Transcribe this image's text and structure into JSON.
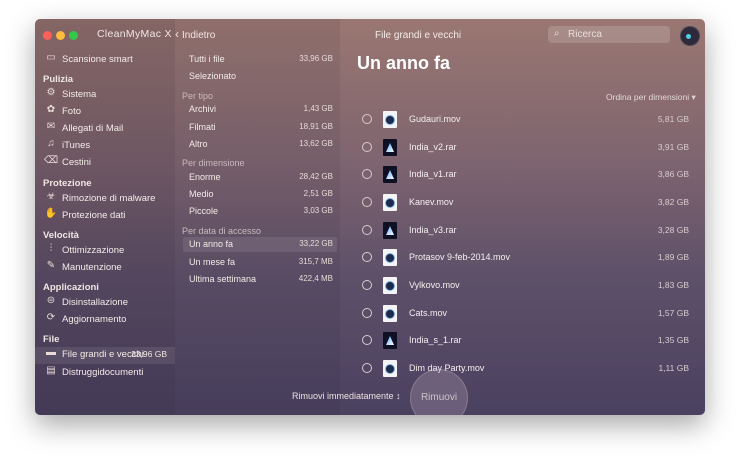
{
  "app": {
    "title": "CleanMyMac X",
    "window_title": "File grandi e vecchi"
  },
  "toolbar": {
    "back_label": "Indietro"
  },
  "search": {
    "placeholder": "Ricerca"
  },
  "sidebar": {
    "top_item": {
      "icon": "monitor-icon",
      "label": "Scansione smart"
    },
    "sections": [
      {
        "label": "Pulizia",
        "items": [
          {
            "icon": "gear-icon",
            "label": "Sistema"
          },
          {
            "icon": "flower-icon",
            "label": "Foto"
          },
          {
            "icon": "mail-icon",
            "label": "Allegati di Mail"
          },
          {
            "icon": "music-icon",
            "label": "iTunes"
          },
          {
            "icon": "trash-icon",
            "label": "Cestini"
          }
        ]
      },
      {
        "label": "Protezione",
        "items": [
          {
            "icon": "biohazard-icon",
            "label": "Rimozione di malware"
          },
          {
            "icon": "hand-icon",
            "label": "Protezione dati"
          }
        ]
      },
      {
        "label": "Velocità",
        "items": [
          {
            "icon": "sliders-icon",
            "label": "Ottimizzazione"
          },
          {
            "icon": "wrench-icon",
            "label": "Manutenzione"
          }
        ]
      },
      {
        "label": "Applicazioni",
        "items": [
          {
            "icon": "uninstall-icon",
            "label": "Disinstallazione"
          },
          {
            "icon": "update-icon",
            "label": "Aggiornamento"
          }
        ]
      },
      {
        "label": "File",
        "items": [
          {
            "icon": "folder-icon",
            "label": "File grandi e vecchi",
            "size": "33,96 GB"
          },
          {
            "icon": "shredder-icon",
            "label": "Distruggidocumenti"
          }
        ]
      }
    ]
  },
  "middle": {
    "all_files": {
      "label": "Tutti i file",
      "size": "33,96 GB"
    },
    "selected": {
      "label": "Selezionato"
    },
    "groups": [
      {
        "header": "Per tipo",
        "rows": [
          {
            "label": "Archivi",
            "size": "1,43 GB"
          },
          {
            "label": "Filmati",
            "size": "18,91 GB"
          },
          {
            "label": "Altro",
            "size": "13,62 GB"
          }
        ]
      },
      {
        "header": "Per dimensione",
        "rows": [
          {
            "label": "Enorme",
            "size": "28,42 GB"
          },
          {
            "label": "Medio",
            "size": "2,51 GB"
          },
          {
            "label": "Piccole",
            "size": "3,03 GB"
          }
        ]
      },
      {
        "header": "Per data di accesso",
        "rows": [
          {
            "label": "Un anno fa",
            "size": "33,22 GB"
          },
          {
            "label": "Un mese fa",
            "size": "315,7 MB"
          },
          {
            "label": "Ultima settimana",
            "size": "422,4 MB"
          }
        ]
      }
    ]
  },
  "main": {
    "title": "Un anno fa",
    "sort_label": "Ordina per dimensioni ▾",
    "files": [
      {
        "name": "Gudauri.mov",
        "size": "5,81 GB",
        "type": "mov"
      },
      {
        "name": "India_v2.rar",
        "size": "3,91 GB",
        "type": "rar"
      },
      {
        "name": "India_v1.rar",
        "size": "3,86 GB",
        "type": "rar"
      },
      {
        "name": "Kanev.mov",
        "size": "3,82 GB",
        "type": "mov"
      },
      {
        "name": "India_v3.rar",
        "size": "3,28 GB",
        "type": "rar"
      },
      {
        "name": "Protasov 9-feb-2014.mov",
        "size": "1,89 GB",
        "type": "mov"
      },
      {
        "name": "Vylkovo.mov",
        "size": "1,83 GB",
        "type": "mov"
      },
      {
        "name": "Cats.mov",
        "size": "1,57 GB",
        "type": "mov"
      },
      {
        "name": "India_s_1.rar",
        "size": "1,35 GB",
        "type": "rar"
      },
      {
        "name": "Dim        day Party.mov",
        "size": "1,11 GB",
        "type": "mov"
      }
    ]
  },
  "footer": {
    "action_label": "Rimuovi immediatamente ↕",
    "remove_label": "Rimuovi"
  }
}
